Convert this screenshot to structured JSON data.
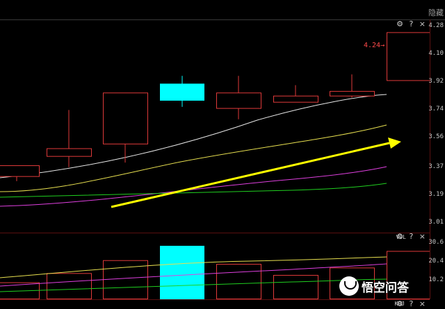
{
  "toolbar": {
    "hide_label": "隐藏"
  },
  "main_panel": {
    "tools": {
      "settings": "⚙",
      "help": "?",
      "close": "×"
    },
    "price_annotation": "4.24→",
    "price_ticks": [
      "4.28",
      "4.10",
      "3.92",
      "3.74",
      "3.56",
      "3.37",
      "3.19",
      "3.01"
    ]
  },
  "vol_panel": {
    "label": "VOL",
    "tools": {
      "settings": "⚙",
      "help": "?",
      "close": "×"
    },
    "ticks": [
      "30.6",
      "20.4",
      "10.2"
    ]
  },
  "kdj_panel": {
    "label": "KDJ",
    "tools": {
      "settings": "⚙",
      "help": "?",
      "close": "×"
    }
  },
  "watermark": "悟空问答",
  "colors": {
    "up_candle": "#e03a3a",
    "down_candle": "#00ffff",
    "ma_white": "#e8e8e8",
    "ma_yellow": "#e8e050",
    "ma_magenta": "#e040e0",
    "ma_green": "#20d020",
    "arrow": "#ffff00"
  },
  "chart_data": {
    "type": "candlestick",
    "y_range": [
      3.01,
      4.28
    ],
    "candles": [
      {
        "open": 3.31,
        "close": 3.38,
        "high": 3.38,
        "low": 3.28,
        "color": "red"
      },
      {
        "open": 3.44,
        "close": 3.49,
        "high": 3.74,
        "low": 3.37,
        "color": "red"
      },
      {
        "open": 3.52,
        "close": 3.85,
        "high": 3.85,
        "low": 3.4,
        "color": "red"
      },
      {
        "open": 3.91,
        "close": 3.8,
        "high": 3.96,
        "low": 3.76,
        "color": "cyan"
      },
      {
        "open": 3.75,
        "close": 3.85,
        "high": 3.96,
        "low": 3.68,
        "color": "red"
      },
      {
        "open": 3.79,
        "close": 3.83,
        "high": 3.9,
        "low": 3.79,
        "color": "red"
      },
      {
        "open": 3.83,
        "close": 3.86,
        "high": 3.97,
        "low": 3.82,
        "color": "red"
      },
      {
        "open": 3.93,
        "close": 4.24,
        "high": 4.24,
        "low": 3.93,
        "color": "red"
      }
    ],
    "volumes": [
      9,
      14,
      21,
      29,
      19,
      13,
      17,
      26
    ],
    "vol_range": [
      0,
      32
    ]
  }
}
